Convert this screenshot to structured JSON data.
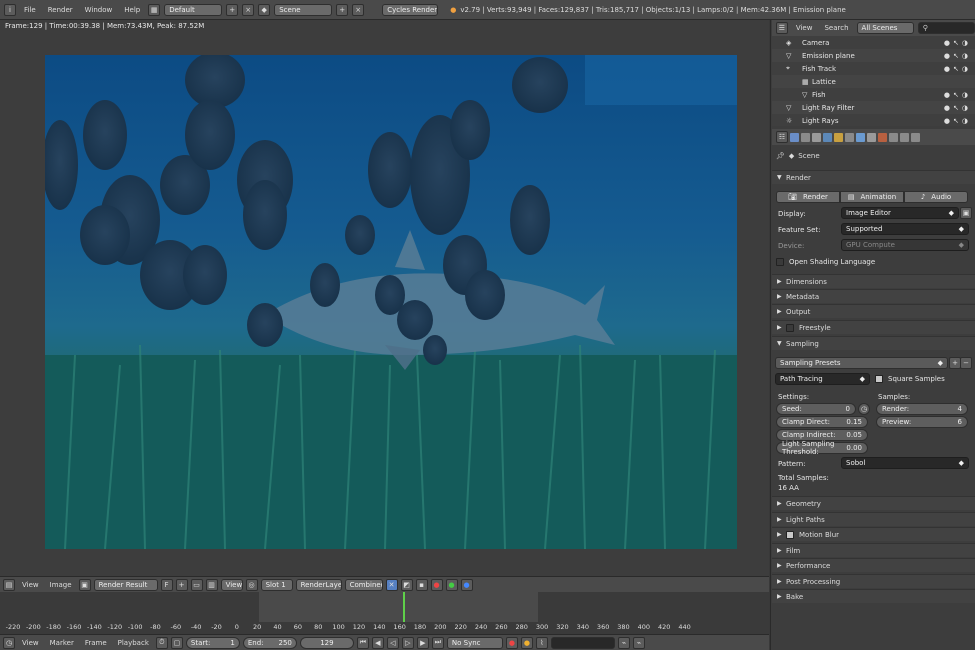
{
  "topbar": {
    "menus": [
      "File",
      "Render",
      "Window",
      "Help"
    ],
    "layout": "Default",
    "scene": "Scene",
    "engine": "Cycles Render",
    "stats": "v2.79 | Verts:93,949 | Faces:129,837 | Tris:185,717 | Objects:1/13 | Lamps:0/2 | Mem:42.36M | Emission plane"
  },
  "viewport": {
    "frame_info": "Frame:129 | Time:00:39.38 | Mem:73.43M, Peak: 87.52M"
  },
  "image_header": {
    "view": "View",
    "image": "Image",
    "image_name": "Render Result",
    "view_menu": "View",
    "slot": "Slot 1",
    "layer": "RenderLayer",
    "pass": "Combined"
  },
  "timeline": {
    "ticks": [
      "-220",
      "-200",
      "-180",
      "-160",
      "-140",
      "-120",
      "-100",
      "-80",
      "-60",
      "-40",
      "-20",
      "0",
      "20",
      "40",
      "60",
      "80",
      "100",
      "120",
      "140",
      "160",
      "180",
      "200",
      "220",
      "240",
      "260",
      "280",
      "300",
      "320",
      "340",
      "360",
      "380",
      "400",
      "420",
      "440"
    ],
    "current_frame": 129
  },
  "footer": {
    "view": "View",
    "marker": "Marker",
    "frame": "Frame",
    "playback": "Playback",
    "start_label": "Start:",
    "start": "1",
    "end_label": "End:",
    "end": "250",
    "current": "129",
    "sync": "No Sync"
  },
  "outliner": {
    "view": "View",
    "search": "Search",
    "scenes": "All Scenes",
    "items": [
      {
        "name": "Camera"
      },
      {
        "name": "Emission plane"
      },
      {
        "name": "Fish Track"
      },
      {
        "name": "Lattice"
      },
      {
        "name": "Fish"
      },
      {
        "name": "Light Ray Filter"
      },
      {
        "name": "Light Rays"
      }
    ]
  },
  "properties": {
    "scene": "Scene",
    "render_panel": "Render",
    "render_buttons": [
      "Render",
      "Animation",
      "Audio"
    ],
    "display_label": "Display:",
    "display_value": "Image Editor",
    "feature_label": "Feature Set:",
    "feature_value": "Supported",
    "device_label": "Device:",
    "device_value": "GPU Compute",
    "osl": "Open Shading Language",
    "collapsed_panels_1": [
      "Dimensions",
      "Metadata",
      "Output",
      "Freestyle"
    ],
    "sampling": "Sampling",
    "presets": "Sampling Presets",
    "integrator": "Path Tracing",
    "square_samples": "Square Samples",
    "settings_label": "Settings:",
    "samples_label": "Samples:",
    "seed_label": "Seed:",
    "seed": "0",
    "clamp_direct_label": "Clamp Direct:",
    "clamp_direct": "0.15",
    "clamp_indirect_label": "Clamp Indirect:",
    "clamp_indirect": "0.05",
    "light_threshold_label": "Light Sampling Threshold:",
    "light_threshold": "0.00",
    "render_samples_label": "Render:",
    "render_samples": "4",
    "preview_samples_label": "Preview:",
    "preview_samples": "6",
    "pattern_label": "Pattern:",
    "pattern": "Sobol",
    "total_samples_label": "Total Samples:",
    "total_samples": "16 AA",
    "collapsed_panels_2": [
      "Geometry",
      "Light Paths",
      "Motion Blur",
      "Film",
      "Performance",
      "Post Processing",
      "Bake"
    ]
  }
}
